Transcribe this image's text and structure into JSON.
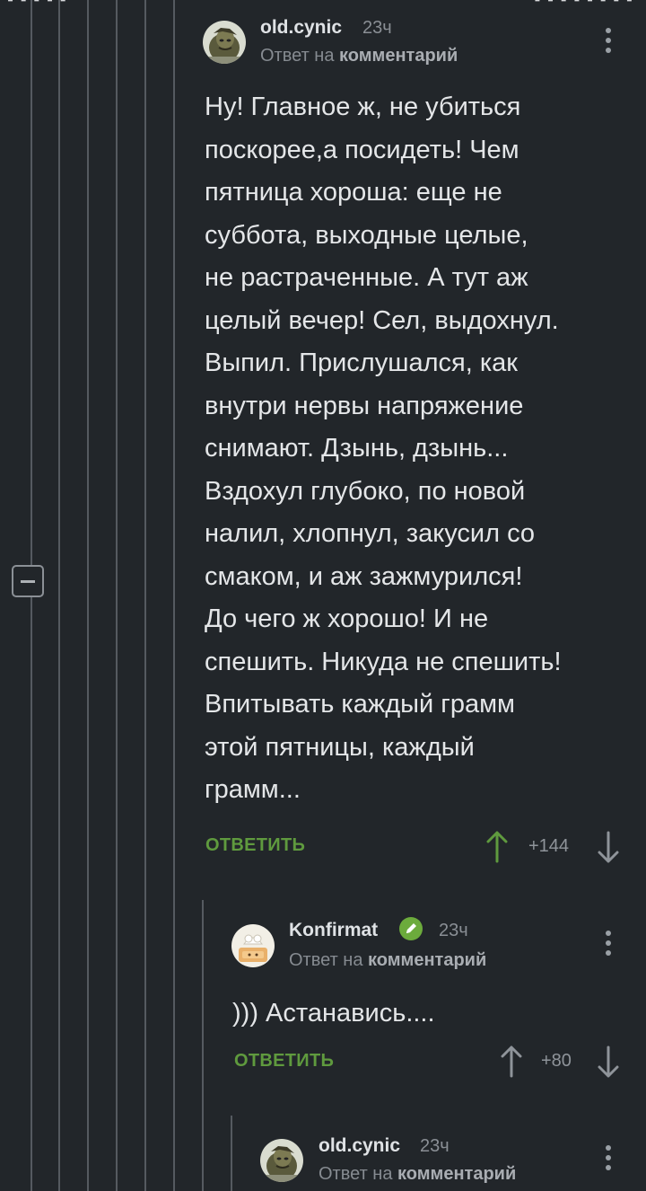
{
  "colors": {
    "background": "#22262a",
    "accent_green": "#5f9a3e",
    "verified_green": "#6cab3c",
    "thread_line": "#555a60"
  },
  "comments": [
    {
      "username": "old.cynic",
      "time": "23ч",
      "reply_prefix": "Ответ на ",
      "reply_target": "комментарий",
      "avatar_icon": "avatar-old-cynic",
      "body_lines": [
        "Ну! Главное ж, не убиться",
        "поскорее,а посидеть! Чем",
        "пятница хороша: еще не",
        "суббота, выходные целые,",
        "не растраченные. А тут аж",
        "целый вечер! Сел, выдохнул.",
        "Выпил. Прислушался, как",
        "внутри нервы напряжение",
        "снимают. Дзынь, дзынь...",
        "Вздохул глубоко, по новой",
        "налил, хлопнул, закусил со",
        "смаком, и аж зажмурился!",
        "До чего ж хорошо!  И не",
        "спешить. Никуда не спешить!",
        "Впитывать каждый грамм",
        "этой пятницы, каждый",
        "грамм..."
      ],
      "reply_label": "ОТВЕТИТЬ",
      "score": "+144"
    },
    {
      "username": "Konfirmat",
      "verified": true,
      "time": "23ч",
      "reply_prefix": "Ответ на ",
      "reply_target": "комментарий",
      "avatar_icon": "avatar-konfirmat",
      "body_lines": [
        ")))  Астанавись...."
      ],
      "reply_label": "ОТВЕТИТЬ",
      "score": "+80"
    },
    {
      "username": "old.cynic",
      "time": "23ч",
      "reply_prefix": "Ответ на ",
      "reply_target": "комментарий",
      "avatar_icon": "avatar-old-cynic"
    }
  ],
  "icons": {
    "upvote": "arrow-up-icon",
    "downvote": "arrow-down-icon",
    "menu": "more-vertical-icon",
    "collapse": "minus-icon",
    "verified": "pencil-badge-icon"
  }
}
